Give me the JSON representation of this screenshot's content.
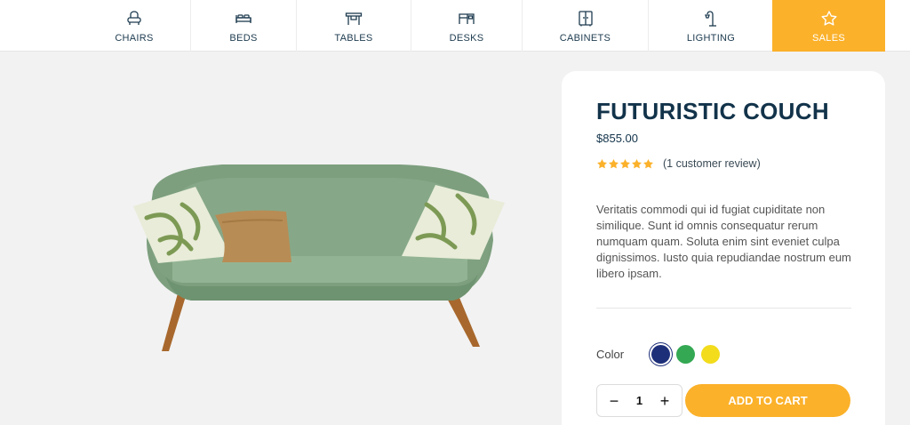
{
  "nav": {
    "items": [
      {
        "label": "CHAIRS",
        "icon": "chair-icon"
      },
      {
        "label": "BEDS",
        "icon": "bed-icon"
      },
      {
        "label": "TABLES",
        "icon": "table-icon"
      },
      {
        "label": "DESKS",
        "icon": "desk-icon"
      },
      {
        "label": "CABINETS",
        "icon": "cabinet-icon"
      },
      {
        "label": "LIGHTING",
        "icon": "lamp-icon"
      },
      {
        "label": "SALES",
        "icon": "star-icon"
      }
    ],
    "active_color": "#fbb12a"
  },
  "product": {
    "title": "FUTURISTIC COUCH",
    "price": "$855.00",
    "rating": 5,
    "review_text": "(1 customer review)",
    "description": "Veritatis commodi qui id fugiat cupiditate non similique. Sunt id omnis consequatur rerum numquam quam. Soluta enim sint eveniet culpa dignissimos. Iusto quia repudiandae nostrum eum libero ipsam.",
    "color_label": "Color",
    "colors": [
      "#1e2f7a",
      "#34a853",
      "#f2dc1c"
    ],
    "selected_color": "#1e2f7a",
    "quantity": "1",
    "qty_minus": "−",
    "qty_plus": "+",
    "add_to_cart": "ADD TO CART",
    "star_color": "#fbb12a"
  }
}
